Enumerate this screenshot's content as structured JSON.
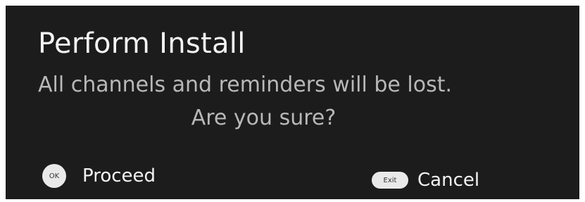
{
  "dialog": {
    "title": "Perform Install",
    "message": "All channels and reminders will be lost.",
    "question": "Are you sure?"
  },
  "actions": {
    "proceed": {
      "key_label": "OK",
      "label": "Proceed"
    },
    "cancel": {
      "key_label": "Exit",
      "label": "Cancel"
    }
  },
  "colors": {
    "background": "#1c1c1c",
    "title_text": "#f4f4f4",
    "body_text": "#b8b8b8",
    "key_button": "#e9e9e9"
  }
}
